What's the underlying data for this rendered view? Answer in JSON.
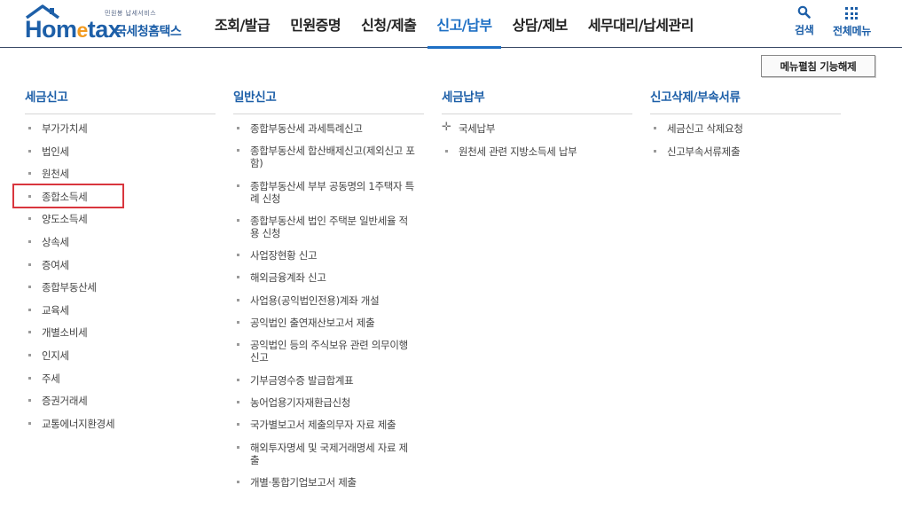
{
  "logo": {
    "sub_text": "민원봉 납세서비스",
    "main_text_a": "Hom",
    "main_text_e": "e",
    "main_text_b": "tax",
    "kr_text": "국세청홈택스",
    "accent_color": "#1d5fa8",
    "roof_color": "#1d5fa8"
  },
  "gnb": {
    "items": [
      {
        "label": "조회/발급"
      },
      {
        "label": "민원증명"
      },
      {
        "label": "신청/제출"
      },
      {
        "label": "신고/납부"
      },
      {
        "label": "상담/제보"
      },
      {
        "label": "세무대리/납세관리"
      }
    ],
    "active": "신고/납부"
  },
  "util": {
    "search_label": "검색",
    "all_menu_label": "전체메뉴"
  },
  "toggle_button_label": "메뉴펼침 기능해제",
  "columns": [
    {
      "title": "세금신고",
      "items": [
        "부가가치세",
        "법인세",
        "원천세",
        "종합소득세",
        "양도소득세",
        "상속세",
        "증여세",
        "종합부동산세",
        "교육세",
        "개별소비세",
        "인지세",
        "주세",
        "증권거래세",
        "교통에너지환경세"
      ]
    },
    {
      "title": "일반신고",
      "items": [
        "종합부동산세 과세특례신고",
        "종합부동산세 합산배제신고(제외신고 포함)",
        "종합부동산세 부부 공동명의 1주택자 특례 신청",
        "종합부동산세 법인 주택분 일반세율 적용 신청",
        "사업장현황 신고",
        "해외금융계좌 신고",
        "사업용(공익법인전용)계좌 개설",
        "공익법인 출연재산보고서 제출",
        "공익법인 등의 주식보유 관련 의무이행 신고",
        "기부금영수증 발급합계표",
        "농어업용기자재환급신청",
        "국가별보고서 제출의무자 자료 제출",
        "해외투자명세 및 국제거래명세 자료 제출",
        "개별·통합기업보고서 제출"
      ]
    },
    {
      "title": "세금납부",
      "items": [
        "국세납부",
        "원천세 관련 지방소득세 납부"
      ]
    },
    {
      "title": "신고삭제/부속서류",
      "items": [
        "세금신고 삭제요청",
        "신고부속서류제출"
      ]
    }
  ],
  "highlight_color": "#d9363e",
  "icons": {
    "search": "search-icon",
    "all_menu": "grid-icon",
    "expand": "plus-icon"
  }
}
